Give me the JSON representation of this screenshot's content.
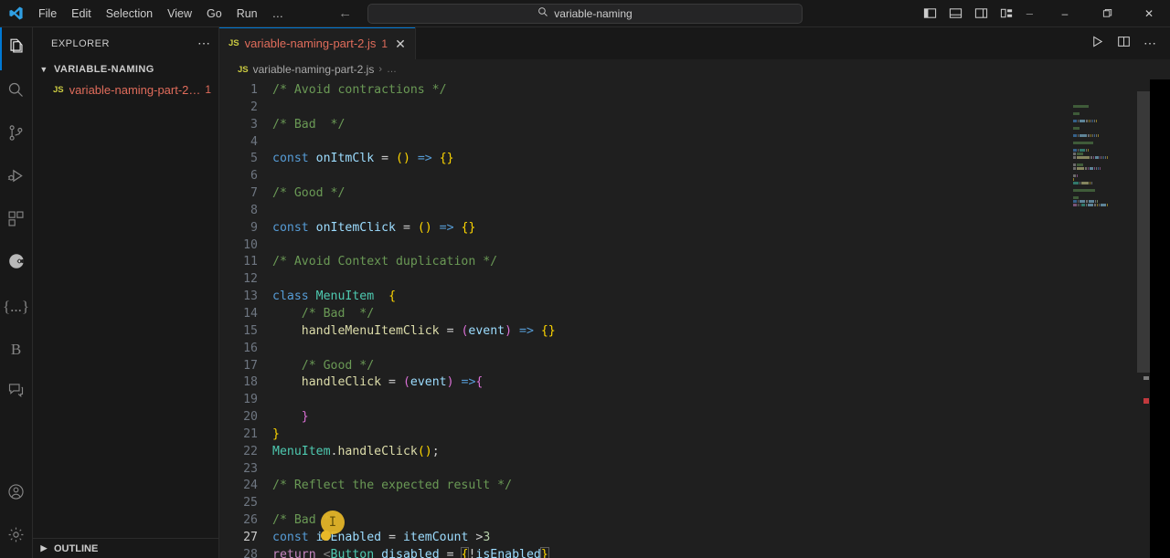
{
  "titlebar": {
    "logo_icon": "vscode-logo-icon",
    "menus": [
      "File",
      "Edit",
      "Selection",
      "View",
      "Go",
      "Run",
      "…"
    ],
    "nav_back_icon": "arrow-left-icon",
    "nav_forward_icon": "arrow-right-icon",
    "command_center": {
      "icon": "search-icon",
      "value": "variable-naming"
    },
    "layout_icons": [
      "toggle-primary-sidebar-icon",
      "toggle-panel-icon",
      "toggle-secondary-sidebar-icon",
      "customize-layout-icon"
    ],
    "window_controls": {
      "minimize": "–",
      "maximize": "❐",
      "close": "✕"
    }
  },
  "activitybar": {
    "items": [
      {
        "name": "explorer",
        "icon": "files-icon",
        "active": true
      },
      {
        "name": "search",
        "icon": "search-icon",
        "active": false
      },
      {
        "name": "source-control",
        "icon": "source-control-icon",
        "active": false
      },
      {
        "name": "run-and-debug",
        "icon": "run-debug-icon",
        "active": false
      },
      {
        "name": "extensions",
        "icon": "extensions-icon",
        "active": false
      },
      {
        "name": "quokka",
        "icon": "quokka-icon",
        "active": false
      },
      {
        "name": "json-tools",
        "icon": "braces-icon",
        "active": false,
        "glyph": "{...}"
      },
      {
        "name": "bookmarks",
        "icon": "bookmark-b-icon",
        "active": false,
        "glyph": "B"
      },
      {
        "name": "comments",
        "icon": "comment-icon",
        "active": false
      }
    ],
    "bottom_items": [
      {
        "name": "accounts",
        "icon": "account-icon"
      },
      {
        "name": "settings",
        "icon": "gear-icon"
      }
    ]
  },
  "sidebar": {
    "title": "EXPLORER",
    "more_actions_icon": "ellipsis-icon",
    "folder": {
      "name": "VARIABLE-NAMING",
      "expanded": true,
      "chevron_icon": "chevron-down-icon"
    },
    "files": [
      {
        "badge": "JS",
        "name": "variable-naming-part-2…",
        "problem_count": "1",
        "icon": "javascript-file-icon"
      }
    ],
    "bottom_section": {
      "label": "OUTLINE",
      "chevron_icon": "chevron-right-icon"
    }
  },
  "editor": {
    "tabs": [
      {
        "badge": "JS",
        "label": "variable-naming-part-2.js",
        "problem_count": "1",
        "close_icon": "close-icon",
        "active": true
      }
    ],
    "actions": [
      {
        "name": "run-file",
        "icon": "play-icon"
      },
      {
        "name": "split-editor-right",
        "icon": "split-editor-icon"
      },
      {
        "name": "more-editor-actions",
        "icon": "ellipsis-icon"
      }
    ],
    "breadcrumb": {
      "badge": "JS",
      "file": "variable-naming-part-2.js",
      "separator": "›",
      "tail": "…"
    },
    "cursor": {
      "icon": "text-cursor-icon",
      "color": "#e8b828",
      "line": 27
    },
    "code_lines": [
      {
        "n": 1,
        "tokens": [
          {
            "t": "/* Avoid contractions */",
            "c": "t-cmt"
          }
        ]
      },
      {
        "n": 2,
        "tokens": []
      },
      {
        "n": 3,
        "tokens": [
          {
            "t": "/* Bad  */",
            "c": "t-cmt"
          }
        ]
      },
      {
        "n": 4,
        "tokens": []
      },
      {
        "n": 5,
        "tokens": [
          {
            "t": "const",
            "c": "t-kw"
          },
          {
            "t": " ",
            "c": "t-pun"
          },
          {
            "t": "onItmClk",
            "c": "t-var"
          },
          {
            "t": " = ",
            "c": "t-pun"
          },
          {
            "t": "()",
            "c": "t-p1"
          },
          {
            "t": " ",
            "c": "t-pun"
          },
          {
            "t": "=>",
            "c": "t-op"
          },
          {
            "t": " ",
            "c": "t-pun"
          },
          {
            "t": "{}",
            "c": "t-p1"
          }
        ]
      },
      {
        "n": 6,
        "tokens": []
      },
      {
        "n": 7,
        "tokens": [
          {
            "t": "/* Good */",
            "c": "t-cmt"
          }
        ]
      },
      {
        "n": 8,
        "tokens": []
      },
      {
        "n": 9,
        "tokens": [
          {
            "t": "const",
            "c": "t-kw"
          },
          {
            "t": " ",
            "c": "t-pun"
          },
          {
            "t": "onItemClick",
            "c": "t-var"
          },
          {
            "t": " = ",
            "c": "t-pun"
          },
          {
            "t": "()",
            "c": "t-p1"
          },
          {
            "t": " ",
            "c": "t-pun"
          },
          {
            "t": "=>",
            "c": "t-op"
          },
          {
            "t": " ",
            "c": "t-pun"
          },
          {
            "t": "{}",
            "c": "t-p1"
          }
        ]
      },
      {
        "n": 10,
        "tokens": []
      },
      {
        "n": 11,
        "tokens": [
          {
            "t": "/* Avoid Context duplication */",
            "c": "t-cmt"
          }
        ]
      },
      {
        "n": 12,
        "tokens": []
      },
      {
        "n": 13,
        "tokens": [
          {
            "t": "class",
            "c": "t-kw"
          },
          {
            "t": " ",
            "c": "t-pun"
          },
          {
            "t": "MenuItem",
            "c": "t-cls"
          },
          {
            "t": "  ",
            "c": "t-pun"
          },
          {
            "t": "{",
            "c": "t-p1"
          }
        ]
      },
      {
        "n": 14,
        "tokens": [
          {
            "t": "    ",
            "c": "t-pun"
          },
          {
            "t": "/* Bad  */",
            "c": "t-cmt"
          }
        ]
      },
      {
        "n": 15,
        "tokens": [
          {
            "t": "    ",
            "c": "t-pun"
          },
          {
            "t": "handleMenuItemClick",
            "c": "t-fn"
          },
          {
            "t": " = ",
            "c": "t-pun"
          },
          {
            "t": "(",
            "c": "t-p2"
          },
          {
            "t": "event",
            "c": "t-var"
          },
          {
            "t": ")",
            "c": "t-p2"
          },
          {
            "t": " ",
            "c": "t-pun"
          },
          {
            "t": "=>",
            "c": "t-op"
          },
          {
            "t": " ",
            "c": "t-pun"
          },
          {
            "t": "{}",
            "c": "t-p1"
          }
        ]
      },
      {
        "n": 16,
        "tokens": []
      },
      {
        "n": 17,
        "tokens": [
          {
            "t": "    ",
            "c": "t-pun"
          },
          {
            "t": "/* Good */",
            "c": "t-cmt"
          }
        ]
      },
      {
        "n": 18,
        "tokens": [
          {
            "t": "    ",
            "c": "t-pun"
          },
          {
            "t": "handleClick",
            "c": "t-fn"
          },
          {
            "t": " = ",
            "c": "t-pun"
          },
          {
            "t": "(",
            "c": "t-p2"
          },
          {
            "t": "event",
            "c": "t-var"
          },
          {
            "t": ")",
            "c": "t-p2"
          },
          {
            "t": " ",
            "c": "t-pun"
          },
          {
            "t": "=>",
            "c": "t-op"
          },
          {
            "t": "{",
            "c": "t-p2"
          }
        ]
      },
      {
        "n": 19,
        "tokens": []
      },
      {
        "n": 20,
        "tokens": [
          {
            "t": "    ",
            "c": "t-pun"
          },
          {
            "t": "}",
            "c": "t-p2"
          }
        ]
      },
      {
        "n": 21,
        "tokens": [
          {
            "t": "}",
            "c": "t-p1"
          }
        ]
      },
      {
        "n": 22,
        "tokens": [
          {
            "t": "MenuItem",
            "c": "t-cls"
          },
          {
            "t": ".",
            "c": "t-pun"
          },
          {
            "t": "handleClick",
            "c": "t-fn"
          },
          {
            "t": "()",
            "c": "t-p1"
          },
          {
            "t": ";",
            "c": "t-pun"
          }
        ]
      },
      {
        "n": 23,
        "tokens": []
      },
      {
        "n": 24,
        "tokens": [
          {
            "t": "/* Reflect the expected result */",
            "c": "t-cmt"
          }
        ]
      },
      {
        "n": 25,
        "tokens": []
      },
      {
        "n": 26,
        "tokens": [
          {
            "t": "/* Bad */",
            "c": "t-cmt"
          }
        ]
      },
      {
        "n": 27,
        "tokens": [
          {
            "t": "const",
            "c": "t-kw"
          },
          {
            "t": " ",
            "c": "t-pun"
          },
          {
            "t": "isEnabled",
            "c": "t-var"
          },
          {
            "t": " = ",
            "c": "t-pun"
          },
          {
            "t": "itemCount",
            "c": "t-var"
          },
          {
            "t": " >",
            "c": "t-pun"
          },
          {
            "t": "3",
            "c": "t-num"
          }
        ]
      },
      {
        "n": 28,
        "tokens": [
          {
            "t": "return",
            "c": "t-ctl"
          },
          {
            "t": " ",
            "c": "t-pun"
          },
          {
            "t": "<",
            "c": "t-tag"
          },
          {
            "t": "Button",
            "c": "t-cls"
          },
          {
            "t": " ",
            "c": "t-pun"
          },
          {
            "t": "disabled",
            "c": "t-var"
          },
          {
            "t": " = ",
            "c": "t-pun"
          },
          {
            "t": "{",
            "c": "t-p1 bracket-hl"
          },
          {
            "t": "!",
            "c": "t-pun"
          },
          {
            "t": "isEnabled",
            "c": "t-var"
          },
          {
            "t": "}",
            "c": "t-p1 bracket-hl err-squiggle"
          }
        ]
      }
    ],
    "minimap": {
      "visible": true
    },
    "overview_ruler": {
      "error_marker_color": "#c1393d",
      "cursor_marker_color": "#c4c4c4"
    },
    "scrollbar": {
      "visible": true
    }
  },
  "colors": {
    "accent": "#0078d4",
    "editor_bg": "#1f1f1f",
    "chrome_bg": "#181818",
    "error": "#f14c4c",
    "modified_file": "#e06c5b"
  }
}
